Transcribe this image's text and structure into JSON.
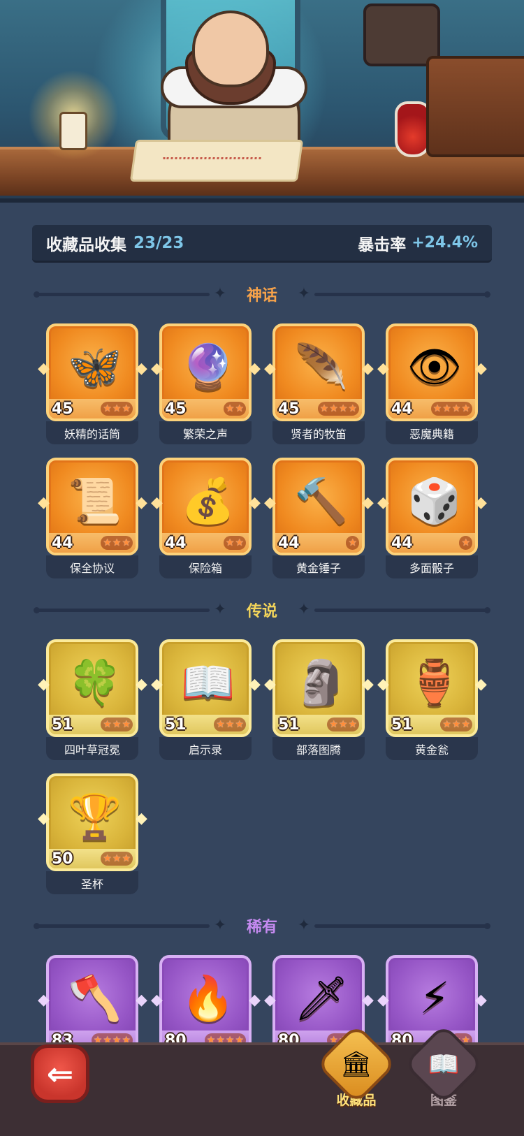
{
  "stats": {
    "collection_label": "收藏品收集",
    "collection_value": "23/23",
    "crit_label": "暴击率",
    "crit_value": "+24.4%"
  },
  "sections": {
    "mythic_title": "神话",
    "legend_title": "传说",
    "rare_title": "稀有"
  },
  "mythic_items": [
    {
      "name": "妖精的话筒",
      "level": "45",
      "stars": 3,
      "icon": "butterfly-microphone-icon"
    },
    {
      "name": "繁荣之声",
      "level": "45",
      "stars": 2,
      "icon": "spirit-orb-icon"
    },
    {
      "name": "贤者的牧笛",
      "level": "45",
      "stars": 4,
      "icon": "flute-icon"
    },
    {
      "name": "恶魔典籍",
      "level": "44",
      "stars": 4,
      "icon": "demon-book-icon"
    },
    {
      "name": "保全协议",
      "level": "44",
      "stars": 3,
      "icon": "contract-scroll-icon"
    },
    {
      "name": "保险箱",
      "level": "44",
      "stars": 2,
      "icon": "gold-chest-icon"
    },
    {
      "name": "黄金锤子",
      "level": "44",
      "stars": 1,
      "icon": "gold-hammer-icon"
    },
    {
      "name": "多面骰子",
      "level": "44",
      "stars": 1,
      "icon": "dice-icon"
    }
  ],
  "legend_items": [
    {
      "name": "四叶草冠冕",
      "level": "51",
      "stars": 3,
      "icon": "clover-crown-icon"
    },
    {
      "name": "启示录",
      "level": "51",
      "stars": 3,
      "icon": "open-book-icon"
    },
    {
      "name": "部落图腾",
      "level": "51",
      "stars": 3,
      "icon": "totem-icon"
    },
    {
      "name": "黄金瓮",
      "level": "51",
      "stars": 3,
      "icon": "golden-urn-icon"
    },
    {
      "name": "圣杯",
      "level": "50",
      "stars": 3,
      "icon": "grail-icon"
    }
  ],
  "rare_items": [
    {
      "level": "83",
      "stars": 4,
      "icon": "axe-icon"
    },
    {
      "level": "80",
      "stars": 4,
      "icon": "phoenix-feather-icon"
    },
    {
      "level": "80",
      "stars": 3,
      "icon": "skull-dagger-icon"
    },
    {
      "level": "80",
      "stars": 2,
      "icon": "lightning-gem-icon"
    }
  ],
  "nav": {
    "collection_label": "收藏品",
    "codex_label": "图鉴"
  },
  "colors": {
    "background": "#35455e",
    "mythic": "#f08a20",
    "legend": "#d9b43a",
    "rare": "#9656c6",
    "accent_text": "#7ec6e8"
  }
}
